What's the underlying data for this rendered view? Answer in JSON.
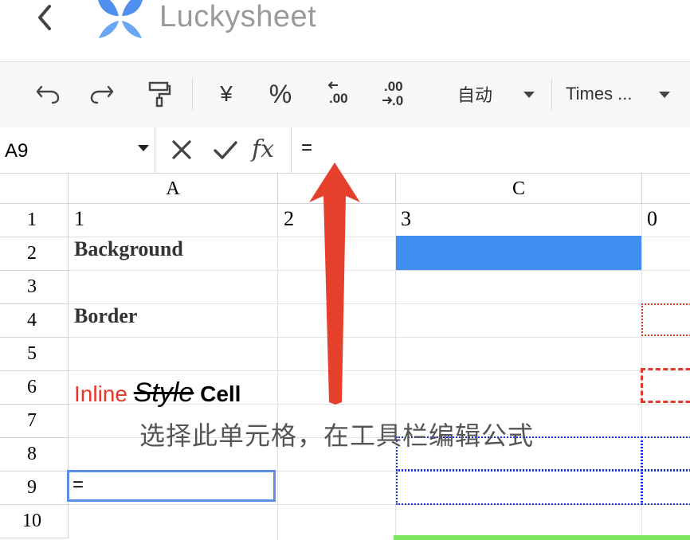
{
  "app": {
    "title": "Luckysheet"
  },
  "toolbar": {
    "currency_symbol": "¥",
    "percent_symbol": "%",
    "decrease_decimal_digits": ".00",
    "increase_decimal_top": ".00",
    "increase_decimal_bottom": ".0",
    "format_label": "自动",
    "font_label": "Times ..."
  },
  "formula_bar": {
    "cell_reference": "A9",
    "fx_label": "fx",
    "formula_value": "="
  },
  "columns": [
    {
      "label": "A"
    },
    {
      "label": ""
    },
    {
      "label": "C"
    },
    {
      "label": ""
    }
  ],
  "rows": [
    "1",
    "2",
    "3",
    "4",
    "5",
    "6",
    "7",
    "8",
    "9",
    "10"
  ],
  "cells": {
    "A1": "1",
    "B1": "2",
    "C1": "3",
    "D1": "0",
    "A2": "Background",
    "A4": "Border",
    "A6_part1": "Inline",
    "A6_part2": "Style",
    "A6_part3": "Cell",
    "A9": "="
  },
  "colors": {
    "background_fill": "#3f8ef0",
    "selection_border": "#5b8fe8",
    "border_dotted_red": "#e5372b",
    "border_dotted_blue": "#1c2fd8",
    "row10_bar": "#7de65f",
    "annotation_arrow": "#e5402b",
    "inline_red": "#e5372b"
  },
  "annotation": {
    "text": "选择此单元格，在工具栏编辑公式"
  }
}
